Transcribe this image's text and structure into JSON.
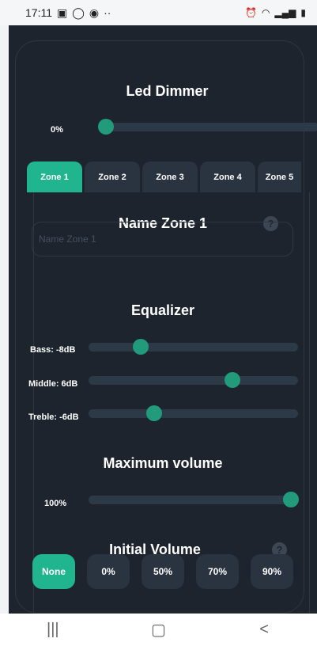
{
  "status_bar": {
    "time": "17:11",
    "icons_left": [
      "gallery-icon",
      "whatsapp-icon",
      "chrome-icon",
      "more-dots-icon"
    ],
    "icons_right": [
      "alarm-icon",
      "wifi-icon",
      "signal-icon",
      "battery-icon"
    ]
  },
  "led_dimmer": {
    "title": "Led Dimmer",
    "value_label": "0%",
    "value": 0
  },
  "zone_tabs": [
    {
      "label": "Zone 1",
      "active": true
    },
    {
      "label": "Zone 2",
      "active": false
    },
    {
      "label": "Zone 3",
      "active": false
    },
    {
      "label": "Zone 4",
      "active": false
    },
    {
      "label": "Zone 5",
      "active": false
    }
  ],
  "zone": {
    "name_title": "Name Zone 1",
    "name_placeholder": "Name Zone 1"
  },
  "equalizer": {
    "title": "Equalizer",
    "bass_label": "Bass: -8dB",
    "bass_value": -8,
    "middle_label": "Middle: 6dB",
    "middle_value": 6,
    "treble_label": "Treble: -6dB",
    "treble_value": -6
  },
  "maximum_volume": {
    "title": "Maximum volume",
    "value_label": "100%",
    "value": 100
  },
  "initial_volume": {
    "title": "Initial Volume",
    "options": [
      {
        "label": "None",
        "active": true
      },
      {
        "label": "0%",
        "active": false
      },
      {
        "label": "50%",
        "active": false
      },
      {
        "label": "70%",
        "active": false
      },
      {
        "label": "90%",
        "active": false
      }
    ]
  },
  "colors": {
    "background": "#1d242d",
    "accent": "#20b58f",
    "slider_thumb": "#229b7d",
    "track": "#2c3a48",
    "button": "#2a3340"
  }
}
